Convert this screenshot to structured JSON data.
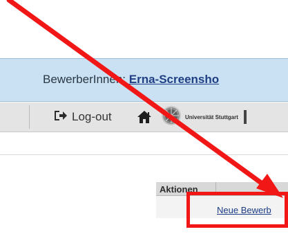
{
  "header": {
    "user_prefix": "BewerberInnen: ",
    "user_name": "Erna-Screensho"
  },
  "toolbar": {
    "logout_label": "Log-out",
    "logout_icon": "logout-icon",
    "home_icon": "home-icon",
    "university_logo_text": "Universität Stuttgart"
  },
  "actions_table": {
    "header_label": "Aktionen",
    "new_application_link": "Neue Bewerb"
  },
  "annotation": {
    "color": "#f21717"
  }
}
